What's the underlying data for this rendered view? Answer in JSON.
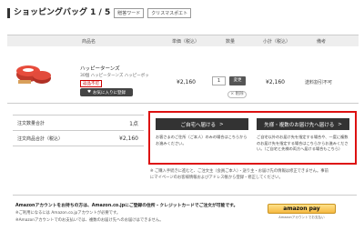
{
  "header": {
    "title": "ショッピングバッグ 1 / 5",
    "tags": [
      "贈答ワード",
      "クリスマスポエト"
    ]
  },
  "table": {
    "headers": [
      "商品名",
      "単価（税込）",
      "数量",
      "小計（税込）",
      "備考"
    ]
  },
  "item": {
    "name": "ハッピーターンズ",
    "desc": "30個 ハッピーターンズ ハッピーボッ",
    "badge": "返品不可",
    "fav_label": "お気に入りに登録",
    "price": "¥2,160",
    "qty": "1",
    "change_label": "変更",
    "delete_label": "× 削除",
    "subtotal": "¥2,160",
    "note": "送料割引不可"
  },
  "summary": {
    "count_label": "注文数量合計",
    "count_value": "1点",
    "total_label": "注文商品合計（税込）",
    "total_value": "¥2,160"
  },
  "options": {
    "home_label": "ご自宅へ届ける",
    "home_desc": "お客さまのご住所（ご本人）のみの場合はこちらからお進みください。",
    "other_label": "先様・複数のお届け先へ届ける",
    "other_desc": "ご自宅以外のお届け先を指定する場合や、一度に複数のお届け先を指定する場合はこちらからお進みください。（ご自宅と先様の両方へ届ける場合もこちら）"
  },
  "notes": {
    "line1": "※ ご購入手続きに進むと、ご注文主（会員ご本人）・送り主・お届け先の情報は修正できません。事前",
    "line2": "にマイページのお客様情報およびアドレス帳から登録・修正してください。"
  },
  "amazon": {
    "title": "Amazonアカウントをお持ちの方は、Amazon.co.jpにご登録の住所・クレジットカードでご注文が可能です。",
    "line1": "※ご利用になるには Amazon.co.jpアカウントが必要です。",
    "line2": "※Amazonアカウントでのお支払いでは、複数のお届け先へのお届けはできません。",
    "btn_label": "amazon pay",
    "btn_sub": "Amazonアカウントでお支払い"
  }
}
